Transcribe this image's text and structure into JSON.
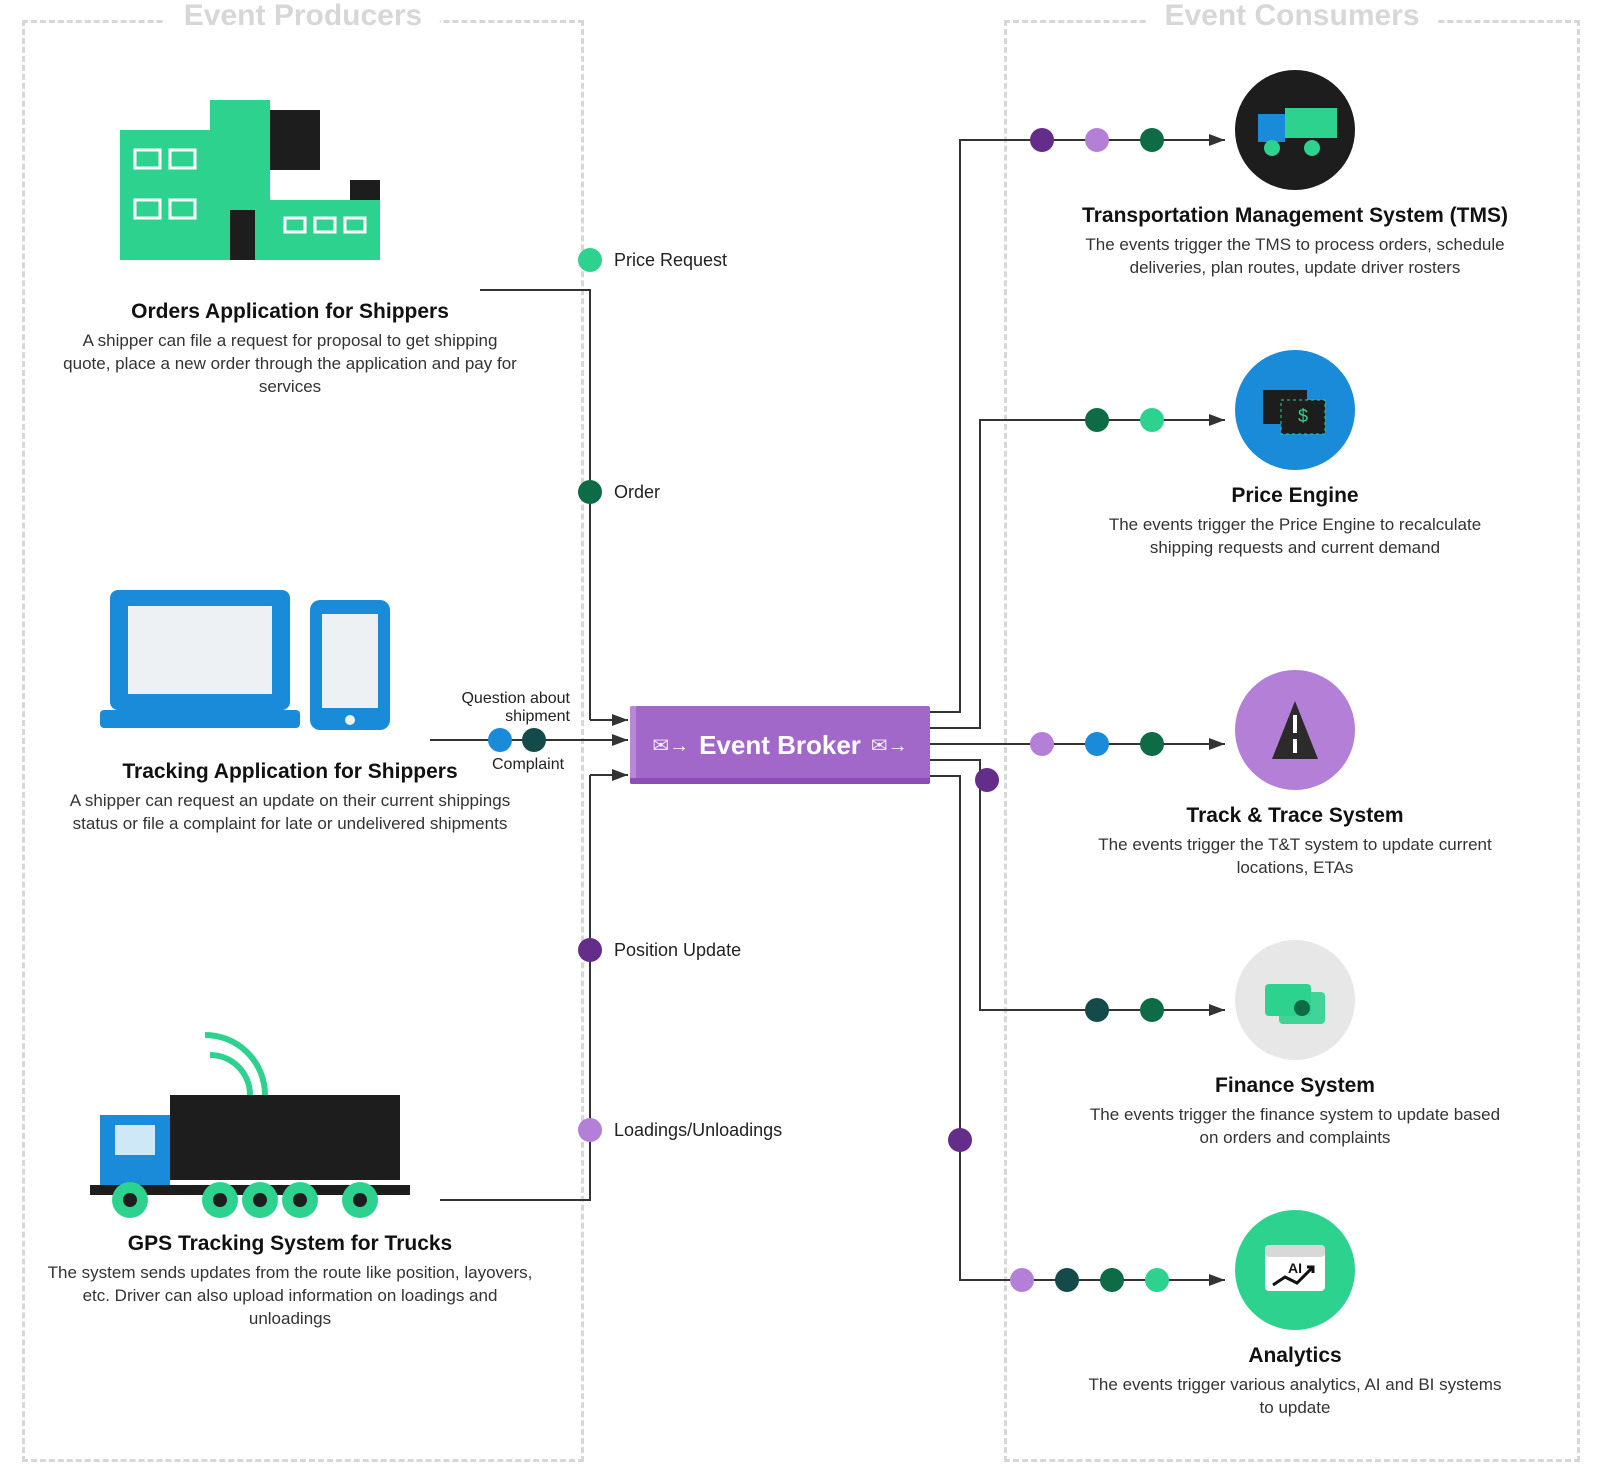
{
  "regions": {
    "producers_label": "Event Producers",
    "consumers_label": "Event Consumers"
  },
  "broker": {
    "label": "Event Broker"
  },
  "producers": {
    "orders": {
      "title": "Orders Application for Shippers",
      "desc": "A shipper can file a request for proposal to get shipping quote, place a new order through the application and pay for services"
    },
    "tracking": {
      "title": "Tracking Application for Shippers",
      "desc": "A shipper can request an update on their current shippings status or file a complaint for late or undelivered shipments"
    },
    "gps": {
      "title": "GPS Tracking System for Trucks",
      "desc": "The system sends updates from the route like position, layovers, etc. Driver can also upload information on loadings and unloadings"
    }
  },
  "producer_events": {
    "price_request": "Price Request",
    "order": "Order",
    "question": "Question about shipment",
    "complaint": "Complaint",
    "position_update": "Position Update",
    "loadings": "Loadings/Unloadings"
  },
  "consumers": {
    "tms": {
      "title": "Transportation Management System (TMS)",
      "desc": "The events trigger the TMS to process orders, schedule deliveries, plan routes, update driver rosters"
    },
    "price": {
      "title": "Price Engine",
      "desc": "The events trigger the Price Engine to recalculate shipping requests and current demand"
    },
    "trace": {
      "title": "Track & Trace System",
      "desc": "The events trigger the T&T system to update current locations, ETAs"
    },
    "finance": {
      "title": "Finance System",
      "desc": "The events trigger the finance system to update based on orders and complaints"
    },
    "analytics": {
      "title": "Analytics",
      "desc": "The events trigger various analytics, AI and BI systems to update"
    }
  },
  "colors": {
    "green": "#2dd28f",
    "dgreen": "#0d6b46",
    "teal": "#144a4a",
    "blue": "#1a8bd8",
    "purple": "#652d8a",
    "lpurple": "#b47fd6",
    "broker": "#a167c9",
    "grey": "#e7e7e7",
    "black": "#1d1d1d"
  }
}
